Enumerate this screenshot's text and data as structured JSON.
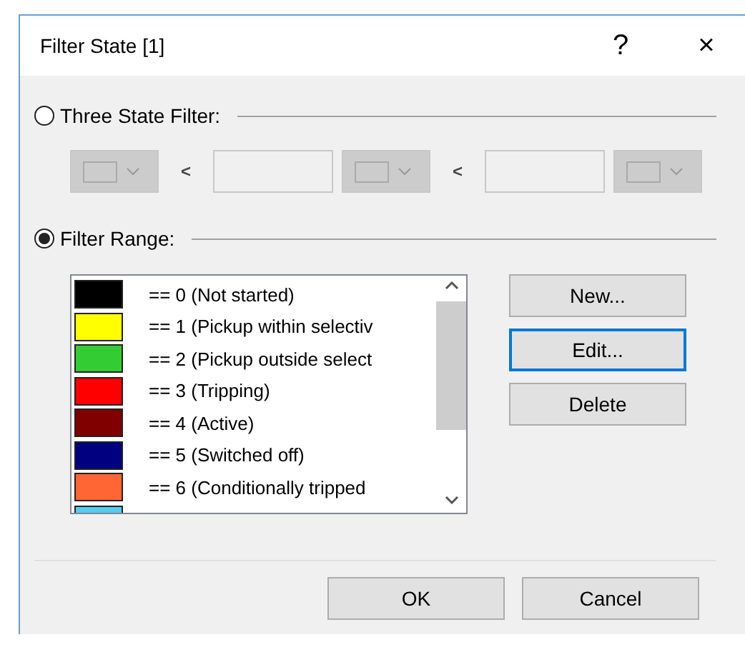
{
  "window": {
    "title": "Filter State [1]",
    "help": "?",
    "close": "×"
  },
  "three_state": {
    "label": "Three State Filter:",
    "selected": false,
    "disabled": true,
    "less_than_1": "<",
    "less_than_2": "<"
  },
  "filter_range": {
    "label": "Filter Range:",
    "selected": true
  },
  "ranges": [
    {
      "label": "== 0 (Not started)",
      "color": "#000000"
    },
    {
      "label": "== 1 (Pickup within selectiv",
      "color": "#ffff00"
    },
    {
      "label": "== 2 (Pickup outside select",
      "color": "#33cc33"
    },
    {
      "label": "== 3 (Tripping)",
      "color": "#ff0000"
    },
    {
      "label": "== 4 (Active)",
      "color": "#800000"
    },
    {
      "label": "== 5 (Switched off)",
      "color": "#000080"
    },
    {
      "label": "== 6 (Conditionally tripped",
      "color": "#ff6633"
    },
    {
      "color": "#55ccee"
    }
  ],
  "side_buttons": [
    {
      "label": "New...",
      "focused": false
    },
    {
      "label": "Edit...",
      "focused": true
    },
    {
      "label": "Delete",
      "focused": false
    }
  ],
  "buttons": [
    "OK",
    "Cancel"
  ]
}
